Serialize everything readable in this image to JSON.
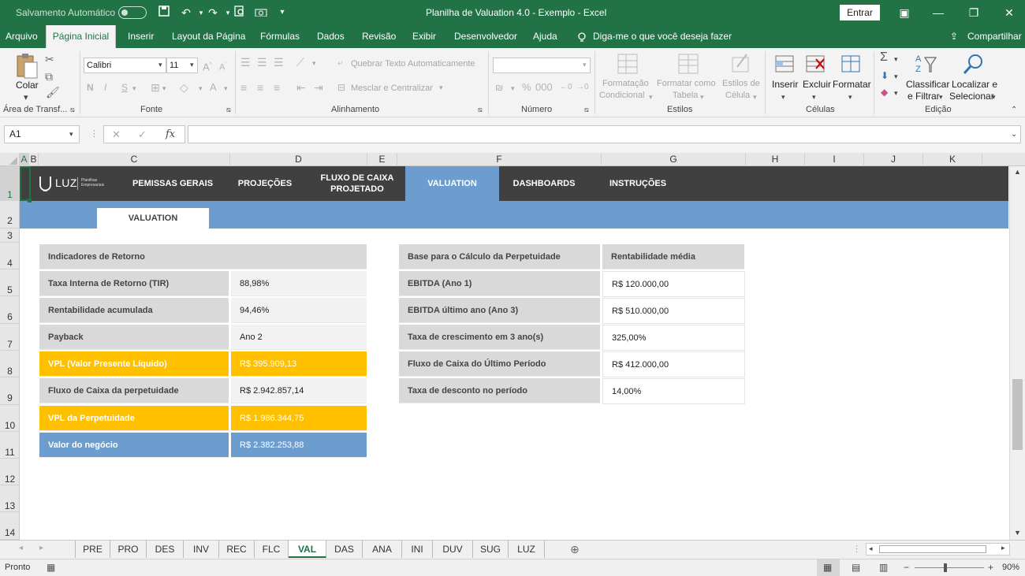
{
  "titlebar": {
    "autosave_label": "Salvamento Automático",
    "title": "Planilha de Valuation 4.0 - Exemplo  -  Excel",
    "signin": "Entrar"
  },
  "ribbon_tabs": [
    "Arquivo",
    "Página Inicial",
    "Inserir",
    "Layout da Página",
    "Fórmulas",
    "Dados",
    "Revisão",
    "Exibir",
    "Desenvolvedor",
    "Ajuda"
  ],
  "tell_me": "Diga-me o que você deseja fazer",
  "share": "Compartilhar",
  "ribbon": {
    "paste": "Colar",
    "font_name": "Calibri",
    "font_size": "11",
    "wrap_text": "Quebrar Texto Automaticamente",
    "merge_center": "Mesclar e Centralizar",
    "cond_format_1": "Formatação",
    "cond_format_2": "Condicional",
    "format_table_1": "Formatar como",
    "format_table_2": "Tabela",
    "cell_styles_1": "Estilos de",
    "cell_styles_2": "Célula",
    "insert": "Inserir",
    "delete": "Excluir",
    "format": "Formatar",
    "sort_1": "Classificar",
    "sort_2": "e Filtrar",
    "find_1": "Localizar e",
    "find_2": "Selecionar",
    "groups": {
      "clipboard": "Área de Transf...",
      "font": "Fonte",
      "alignment": "Alinhamento",
      "number": "Número",
      "styles": "Estilos",
      "cells": "Células",
      "editing": "Edição"
    }
  },
  "formula_bar": {
    "name_box": "A1",
    "formula": ""
  },
  "columns": [
    "A",
    "B",
    "C",
    "D",
    "E",
    "F",
    "G",
    "H",
    "I",
    "J",
    "K"
  ],
  "rows": [
    "1",
    "2",
    "3",
    "4",
    "5",
    "6",
    "7",
    "8",
    "9",
    "10",
    "11",
    "12",
    "13",
    "14"
  ],
  "sheet_nav": {
    "logo": "LUZ",
    "logo_sub_1": "Planilhas",
    "logo_sub_2": "Empresariais",
    "items": [
      "PEMISSAS GERAIS",
      "PROJEÇÕES",
      "FLUXO DE CAIXA PROJETADO",
      "VALUATION",
      "DASHBOARDS",
      "INSTRUÇÕES"
    ],
    "subtab": "VALUATION"
  },
  "left_table": {
    "header": "Indicadores de Retorno",
    "rows": [
      {
        "label": "Taxa Interna de Retorno (TIR)",
        "value": "88,98%"
      },
      {
        "label": "Rentabilidade acumulada",
        "value": "94,46%"
      },
      {
        "label": "Payback",
        "value": "Ano 2"
      },
      {
        "label": "VPL (Valor Presente Líquido)",
        "value": "R$ 395.909,13"
      },
      {
        "label": "Fluxo de Caixa da perpetuidade",
        "value": "R$ 2.942.857,14"
      },
      {
        "label": "VPL da Perpetuidade",
        "value": "R$ 1.986.344,75"
      },
      {
        "label": "Valor do negócio",
        "value": "R$ 2.382.253,88"
      }
    ]
  },
  "right_table": {
    "header": "Base para o Cálculo da Perpetuidade",
    "header2": "Rentabilidade média",
    "rows": [
      {
        "label": "EBITDA (Ano 1)",
        "value": "R$ 120.000,00"
      },
      {
        "label": "EBITDA último ano (Ano 3)",
        "value": "R$ 510.000,00"
      },
      {
        "label": "Taxa de crescimento em 3 ano(s)",
        "value": "325,00%"
      },
      {
        "label": "Fluxo de Caixa do Último Período",
        "value": "R$ 412.000,00"
      },
      {
        "label": "Taxa de desconto no período",
        "value": "14,00%"
      }
    ]
  },
  "sheet_tabs": [
    "PRE",
    "PRO",
    "DES",
    "INV",
    "REC",
    "FLC",
    "VAL",
    "DAS",
    "ANA",
    "INI",
    "DUV",
    "SUG",
    "LUZ"
  ],
  "status": {
    "ready": "Pronto",
    "zoom": "90%"
  }
}
